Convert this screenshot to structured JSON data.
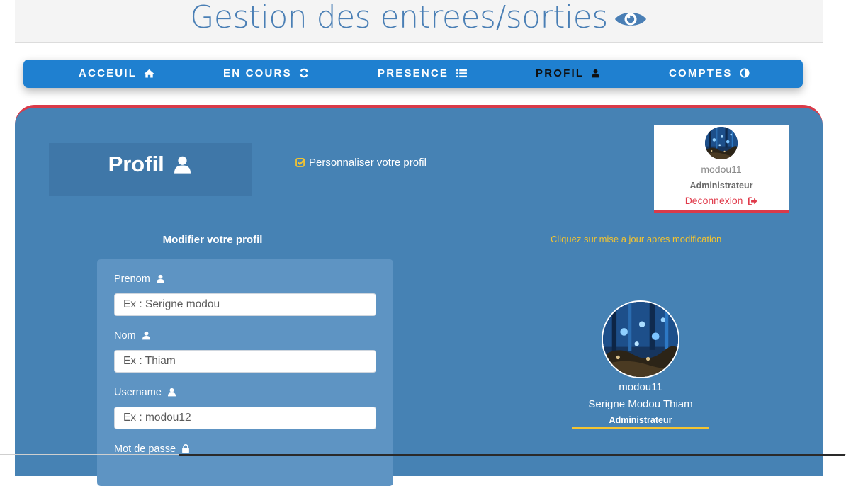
{
  "header": {
    "title": "Gestion des entrees/sorties",
    "icon": "eye-icon",
    "title_color": "#4a7fb5"
  },
  "nav": {
    "items": [
      {
        "label": "ACCEUIL",
        "icon": "home-icon"
      },
      {
        "label": "EN COURS",
        "icon": "refresh-icon"
      },
      {
        "label": "PRESENCE",
        "icon": "list-icon"
      },
      {
        "label": "PROFIL",
        "icon": "user-icon",
        "active": true
      },
      {
        "label": "COMPTES",
        "icon": "adjust-icon"
      }
    ],
    "background": "#1f80d0"
  },
  "panel": {
    "title": "Profil",
    "personalize_label": "Personnaliser votre profil",
    "hint": "Cliquez sur mise a jour apres modification",
    "background": "#4682b4",
    "accent": "#d93a49"
  },
  "user_card": {
    "username": "modou11",
    "role": "Administrateur",
    "logout_label": "Deconnexion"
  },
  "form": {
    "heading": "Modifier votre profil",
    "fields": [
      {
        "label": "Prenom",
        "placeholder": "Ex : Serigne modou",
        "icon": "user-icon"
      },
      {
        "label": "Nom",
        "placeholder": "Ex : Thiam",
        "icon": "user-icon"
      },
      {
        "label": "Username",
        "placeholder": "Ex : modou12",
        "icon": "user-icon"
      },
      {
        "label": "Mot de passe",
        "icon": "lock-icon"
      }
    ]
  },
  "profile_summary": {
    "username": "modou11",
    "full_name": "Serigne Modou Thiam",
    "role": "Administrateur"
  }
}
